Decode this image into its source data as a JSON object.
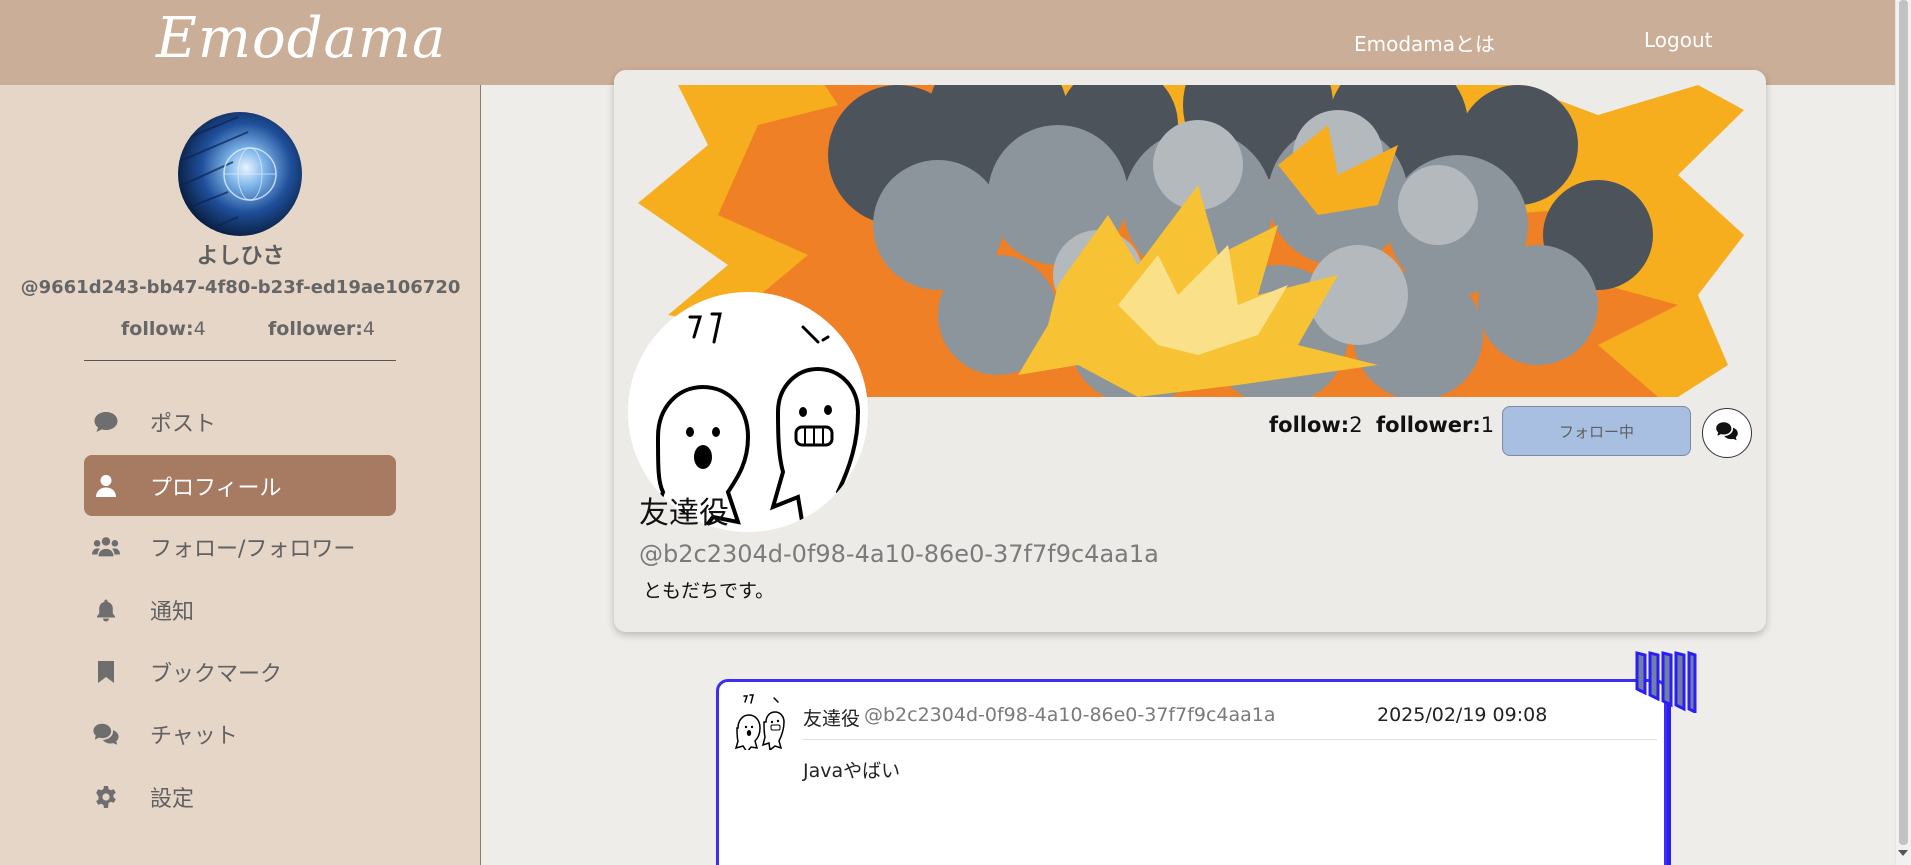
{
  "header": {
    "logo": "Emodama",
    "nav": {
      "about": "Emodamaとは",
      "logout": "Logout"
    }
  },
  "sidebar": {
    "user": {
      "name": "よしひさ",
      "id": "@9661d243-bb47-4f80-b23f-ed19ae106720",
      "follow_label": "follow:",
      "follow_count": "4",
      "follower_label": "follower:",
      "follower_count": "4"
    },
    "menu": [
      {
        "label": "ポスト",
        "icon": "comment-icon",
        "active": false
      },
      {
        "label": "プロフィール",
        "icon": "user-icon",
        "active": true
      },
      {
        "label": "フォロー/フォロワー",
        "icon": "users-icon",
        "active": false
      },
      {
        "label": "通知",
        "icon": "bell-icon",
        "active": false
      },
      {
        "label": "ブックマーク",
        "icon": "bookmark-icon",
        "active": false
      },
      {
        "label": "チャット",
        "icon": "chat-icon",
        "active": false
      },
      {
        "label": "設定",
        "icon": "gear-icon",
        "active": false
      }
    ]
  },
  "profile": {
    "name": "友達役",
    "id": "@b2c2304d-0f98-4a10-86e0-37f7f9c4aa1a",
    "bio": "ともだちです。",
    "follow_label": "follow:",
    "follow_count": "2",
    "follower_label": "follower:",
    "follower_count": "1",
    "follow_button": "フォロー中",
    "chat_icon": "chat-icon"
  },
  "post": {
    "author": "友達役",
    "author_id": "@b2c2304d-0f98-4a10-86e0-37f7f9c4aa1a",
    "date": "2025/02/19 09:08",
    "body": "Javaやばい"
  },
  "colors": {
    "header_bg": "#cbae98",
    "sidebar_bg": "#e6d6c8",
    "active_menu_bg": "#a77a62",
    "follow_button_bg": "#a8bfe1",
    "post_border": "#3b2ff3",
    "main_bg": "#efedea"
  }
}
